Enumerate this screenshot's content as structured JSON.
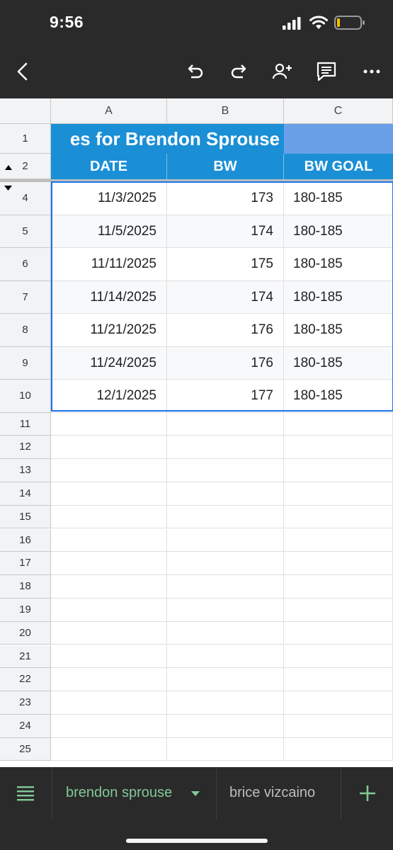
{
  "status_bar": {
    "time": "9:56"
  },
  "columns": [
    "A",
    "B",
    "C"
  ],
  "sheet": {
    "title_fragment": "es for Brendon Sprouse",
    "headers": [
      "DATE",
      "BW",
      "BW GOAL"
    ],
    "header_row_numbers": [
      "1",
      "2"
    ],
    "rows": [
      {
        "row": "4",
        "date": "11/3/2025",
        "bw": "173",
        "goal": "180-185"
      },
      {
        "row": "5",
        "date": "11/5/2025",
        "bw": "174",
        "goal": "180-185"
      },
      {
        "row": "6",
        "date": "11/11/2025",
        "bw": "175",
        "goal": "180-185"
      },
      {
        "row": "7",
        "date": "11/14/2025",
        "bw": "174",
        "goal": "180-185"
      },
      {
        "row": "8",
        "date": "11/21/2025",
        "bw": "176",
        "goal": "180-185"
      },
      {
        "row": "9",
        "date": "11/24/2025",
        "bw": "176",
        "goal": "180-185"
      },
      {
        "row": "10",
        "date": "12/1/2025",
        "bw": "177",
        "goal": "180-185"
      }
    ],
    "empty_rows": [
      "11",
      "12",
      "13",
      "14",
      "15",
      "16",
      "17",
      "18",
      "19",
      "20",
      "21",
      "22",
      "23",
      "24",
      "25"
    ]
  },
  "tabs": {
    "active": "brendon sprouse",
    "other": "brice vizcaino"
  },
  "colors": {
    "header_blue": "#1a8fd6",
    "title_c_blue": "#6aa0e8",
    "active_tab_green": "#81c995",
    "selection_blue": "#1a73e8"
  }
}
